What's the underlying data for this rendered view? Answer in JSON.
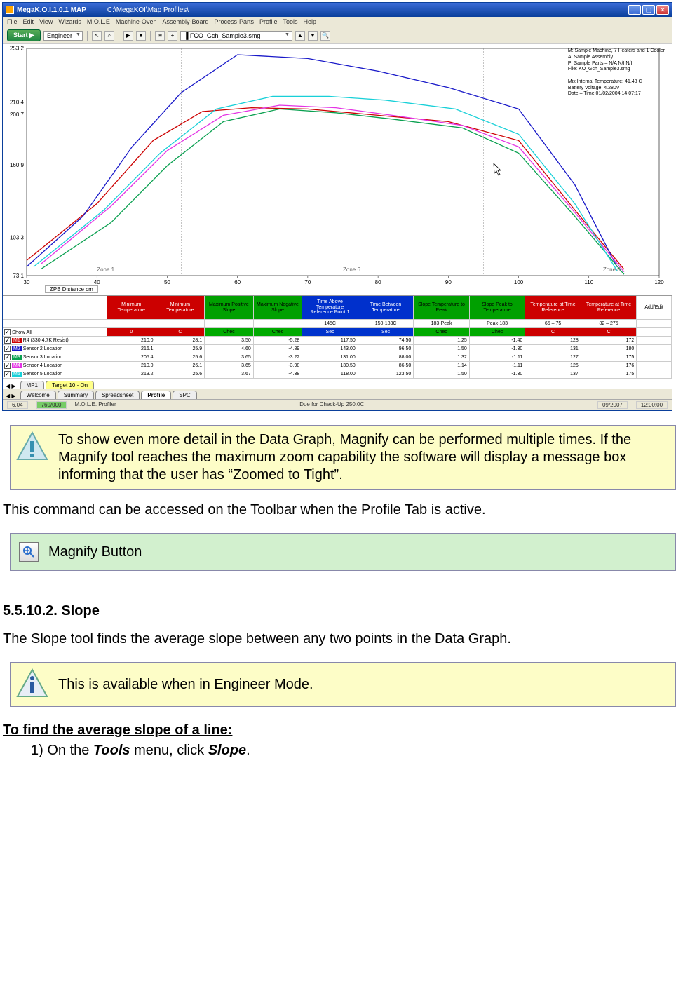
{
  "window": {
    "title1": "MegaK.O.I.1.0.1 MAP",
    "title2": "C:\\MegaKOI\\Map Profiles\\",
    "menu": [
      "File",
      "Edit",
      "View",
      "Wizards",
      "M.O.L.E",
      "Machine-Oven",
      "Assembly-Board",
      "Process-Parts",
      "Profile",
      "Tools",
      "Help"
    ],
    "toolbar": {
      "start": "Start ▶",
      "mode": "Engineer",
      "filename": "▐ FCO_Gch_Sample3.smg"
    }
  },
  "chart_data": {
    "type": "line",
    "ylim": [
      73,
      253
    ],
    "yticks": [
      73.1,
      103.3,
      160.9,
      200.7,
      210.4,
      253.2
    ],
    "xlim": [
      30,
      120
    ],
    "xticks": [
      30,
      40,
      50,
      60,
      70,
      80,
      90,
      100,
      110,
      120
    ],
    "xlabel": "ZPB Distance cm",
    "zones": [
      "Zone 1",
      "Zone 6",
      "Zone 8"
    ],
    "info_lines": [
      "M: Sample Machine, 7 Heaters and 1 Cooler",
      "A: Sample Assembly",
      "P: Sample Parts – N/A   N/I   N/I",
      "File: KO_Gch_Sample3.smg",
      "",
      "Mix Internal Temperature:  41.48 C",
      "Battery Voltage: 4.280V",
      "Date – Time 01/02/2004 14:07:17"
    ],
    "series": [
      {
        "name": "M1",
        "color": "#cc0000",
        "values": [
          [
            30,
            85
          ],
          [
            40,
            130
          ],
          [
            48,
            180
          ],
          [
            55,
            203
          ],
          [
            62,
            206
          ],
          [
            70,
            205
          ],
          [
            80,
            200
          ],
          [
            90,
            195
          ],
          [
            100,
            180
          ],
          [
            108,
            125
          ],
          [
            115,
            78
          ]
        ]
      },
      {
        "name": "M2",
        "color": "#1818c8",
        "values": [
          [
            30,
            80
          ],
          [
            38,
            120
          ],
          [
            45,
            175
          ],
          [
            52,
            218
          ],
          [
            60,
            248
          ],
          [
            70,
            245
          ],
          [
            80,
            235
          ],
          [
            90,
            222
          ],
          [
            100,
            205
          ],
          [
            108,
            145
          ],
          [
            114,
            80
          ]
        ]
      },
      {
        "name": "M3",
        "color": "#0aa050",
        "values": [
          [
            32,
            78
          ],
          [
            42,
            115
          ],
          [
            50,
            160
          ],
          [
            58,
            195
          ],
          [
            66,
            205
          ],
          [
            74,
            202
          ],
          [
            82,
            197
          ],
          [
            92,
            190
          ],
          [
            100,
            170
          ],
          [
            108,
            120
          ],
          [
            115,
            74
          ]
        ]
      },
      {
        "name": "M4",
        "color": "#e433e4",
        "values": [
          [
            32,
            82
          ],
          [
            42,
            128
          ],
          [
            50,
            172
          ],
          [
            58,
            200
          ],
          [
            66,
            208
          ],
          [
            74,
            206
          ],
          [
            82,
            200
          ],
          [
            92,
            192
          ],
          [
            100,
            175
          ],
          [
            108,
            123
          ],
          [
            115,
            76
          ]
        ]
      },
      {
        "name": "M5",
        "color": "#18d0d8",
        "values": [
          [
            31,
            80
          ],
          [
            41,
            125
          ],
          [
            49,
            170
          ],
          [
            57,
            205
          ],
          [
            65,
            215
          ],
          [
            73,
            215
          ],
          [
            81,
            212
          ],
          [
            91,
            205
          ],
          [
            100,
            185
          ],
          [
            108,
            130
          ],
          [
            114,
            77
          ]
        ]
      }
    ]
  },
  "columns": [
    {
      "label": "Minimum Temperature",
      "bg": "#cc0000",
      "fg": "#fff",
      "w": 70
    },
    {
      "label": "Minimum Temperature",
      "bg": "#cc0000",
      "fg": "#fff",
      "w": 70
    },
    {
      "label": "Maximum Positive Slope",
      "bg": "#00a000",
      "fg": "#000",
      "w": 70
    },
    {
      "label": "Maximum Negative Slope",
      "bg": "#00a000",
      "fg": "#000",
      "w": 70
    },
    {
      "label": "Time Above Temperature Reference Point 1",
      "bg": "#0030cc",
      "fg": "#fff",
      "w": 80
    },
    {
      "label": "Time Between Temperature",
      "bg": "#0030cc",
      "fg": "#fff",
      "w": 80
    },
    {
      "label": "Slope Temperature to Peak",
      "bg": "#00a000",
      "fg": "#000",
      "w": 80
    },
    {
      "label": "Slope Peak to Temperature",
      "bg": "#00a000",
      "fg": "#000",
      "w": 80
    },
    {
      "label": "Temperature at Time Reference",
      "bg": "#cc0000",
      "fg": "#fff",
      "w": 80
    },
    {
      "label": "Temperature at Time Reference",
      "bg": "#cc0000",
      "fg": "#fff",
      "w": 80
    },
    {
      "label": "Add/Edit",
      "bg": "#fff",
      "fg": "#000",
      "w": 50
    }
  ],
  "spec_row": [
    "",
    "",
    "",
    "",
    "145C",
    "150-183C",
    "183-Peak",
    "Peak-183",
    "65 – 75",
    "82 – 275",
    ""
  ],
  "limit_row": [
    {
      "t": "0",
      "bg": "#c00",
      "fg": "#fff"
    },
    {
      "t": "C",
      "bg": "#c00",
      "fg": "#fff"
    },
    {
      "t": "Chec",
      "bg": "#0a0"
    },
    {
      "t": "Chec",
      "bg": "#0a0"
    },
    {
      "t": "Sec",
      "bg": "#03c",
      "fg": "#fff"
    },
    {
      "t": "Sec",
      "bg": "#03c",
      "fg": "#fff"
    },
    {
      "t": "Chec",
      "bg": "#0a0"
    },
    {
      "t": "Chec",
      "bg": "#0a0"
    },
    {
      "t": "C",
      "bg": "#c00",
      "fg": "#fff"
    },
    {
      "t": "C",
      "bg": "#c00",
      "fg": "#fff"
    },
    {
      "t": "",
      "bg": "#fff"
    }
  ],
  "rows": [
    {
      "tag": "M1",
      "tagbg": "#cc0000",
      "name": "R4 (330 4.7K Resist)",
      "v": [
        "210.0",
        "28.1",
        "3.50",
        "-5.28",
        "117.50",
        "74.50",
        "1.25",
        "-1.40",
        "128",
        "172"
      ]
    },
    {
      "tag": "M2",
      "tagbg": "#1818c8",
      "name": "Sensor 2 Location",
      "v": [
        "216.1",
        "25.9",
        "4.60",
        "-4.89",
        "143.00",
        "96.50",
        "1.50",
        "-1.30",
        "131",
        "180"
      ]
    },
    {
      "tag": "M3",
      "tagbg": "#0aa050",
      "name": "Sensor 3 Location",
      "v": [
        "205.4",
        "25.6",
        "3.65",
        "-3.22",
        "131.00",
        "88.00",
        "1.32",
        "-1.11",
        "127",
        "175"
      ]
    },
    {
      "tag": "M4",
      "tagbg": "#e433e4",
      "name": "Sensor 4 Location",
      "v": [
        "210.0",
        "26.1",
        "3.65",
        "-3.98",
        "130.50",
        "86.50",
        "1.14",
        "-1.11",
        "126",
        "176"
      ]
    },
    {
      "tag": "M5",
      "tagbg": "#18d0d8",
      "name": "Sensor 5 Location",
      "v": [
        "213.2",
        "25.6",
        "3.67",
        "-4.38",
        "118.00",
        "123.50",
        "1.50",
        "-1.30",
        "137",
        "175"
      ]
    }
  ],
  "showall": "Show All",
  "bottom_tabs_b": [
    "MP1",
    "Target 10 - On"
  ],
  "bottom_tabs": [
    "Welcome",
    "Summary",
    "Spreadsheet",
    "Profile",
    "SPC"
  ],
  "status": {
    "v": "6.04",
    "mid": "M.O.L.E. Profiler",
    "cal": "Due for Check-Up 250.0C",
    "date": "09/2007",
    "time": "12:00:00",
    "pct": "760/000"
  },
  "notes": {
    "tip1": "To show even more detail in the Data Graph, Magnify can be performed multiple times. If the Magnify tool reaches the maximum zoom capability the software will display a message box informing that the user has “Zoomed to Tight”.",
    "access_line": "This command can be accessed on the Toolbar when the Profile Tab is active.",
    "magnify_btn": "Magnify Button",
    "section_num": "5.5.10.2. Slope",
    "slope_intro": "The Slope tool finds the average slope between any two points in the Data Graph.",
    "engineer_note": "This is available when in Engineer Mode.",
    "proc_title": "To find the average slope of a line:",
    "step1_a": "1)  On the ",
    "step1_b": "Tools",
    "step1_c": " menu, click ",
    "step1_d": "Slope",
    "step1_e": "."
  }
}
